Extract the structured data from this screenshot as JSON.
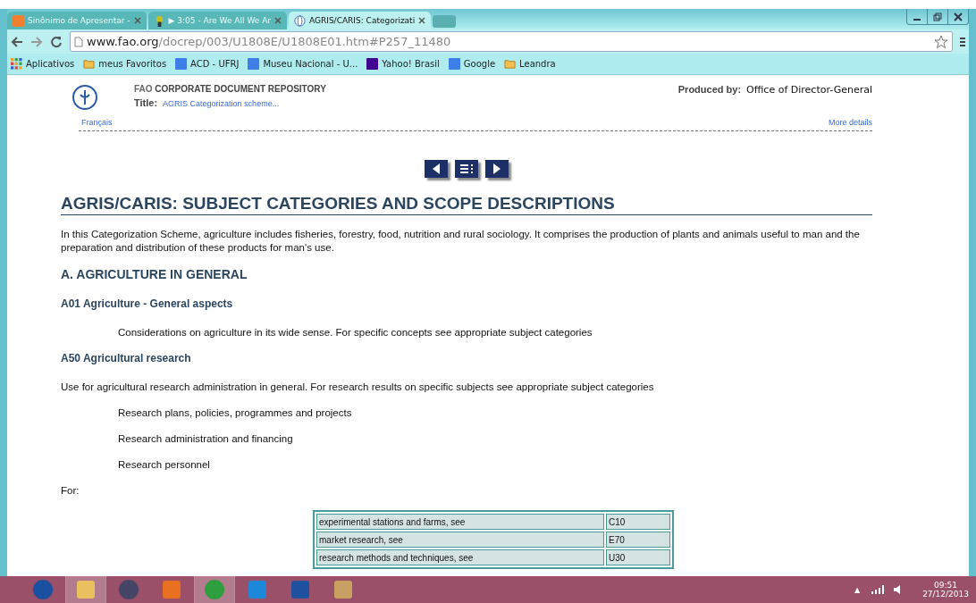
{
  "browser": {
    "tabs": [
      {
        "title": "Sinônimo de Apresentar -",
        "selected": false,
        "kind": "orange"
      },
      {
        "title": "▶ 3:05 - Are We All We Ar",
        "selected": false,
        "kind": "music"
      },
      {
        "title": "AGRIS/CARIS: Categorizati",
        "selected": true,
        "kind": "globe"
      }
    ],
    "url_host": "www.fao.org",
    "url_path": "/docrep/003/U1808E/U1808E01.htm#P257_11480",
    "bookmarks": [
      {
        "label": "Aplicativos",
        "kind": "apps"
      },
      {
        "label": "meus Favoritos",
        "kind": "folder"
      },
      {
        "label": "ACD - UFRJ",
        "kind": "google"
      },
      {
        "label": "Museu Nacional - U...",
        "kind": "google"
      },
      {
        "label": "Yahoo! Brasil",
        "kind": "yahoo"
      },
      {
        "label": "Google",
        "kind": "google"
      },
      {
        "label": "Leandra",
        "kind": "folder"
      }
    ]
  },
  "header": {
    "repo_prefix": "FAO",
    "repo": "CORPORATE DOCUMENT REPOSITORY",
    "title_label": "Title:",
    "title": "AGRIS Categorization scheme...",
    "produced_label": "Produced by:",
    "produced": "Office of Director-General",
    "lang_link": "Français",
    "more_link": "More details"
  },
  "heading": "AGRIS/CARIS: SUBJECT CATEGORIES AND SCOPE DESCRIPTIONS",
  "intro": "In this Categorization Scheme, agriculture includes fisheries, forestry, food, nutrition and rural sociology. It comprises the production of plants and animals useful to man and the preparation and distribution of these products for man's use.",
  "section": "A. AGRICULTURE IN GENERAL",
  "blocks": [
    {
      "kind": "sub",
      "text": "A01 Agriculture - General aspects"
    },
    {
      "kind": "indent",
      "text": "Considerations on agriculture in its wide sense. For specific concepts see appropriate subject categories"
    },
    {
      "kind": "sub",
      "text": "A50 Agricultural research"
    },
    {
      "kind": "para",
      "text": "Use for agricultural research administration in general. For research results on specific subjects see appropriate subject categories"
    },
    {
      "kind": "indent",
      "text": "Research plans, policies, programmes and projects"
    },
    {
      "kind": "indent",
      "text": "Research administration and financing"
    },
    {
      "kind": "indent",
      "text": "Research personnel"
    },
    {
      "kind": "para",
      "text": "For:"
    }
  ],
  "table": {
    "rows": [
      {
        "text": "experimental stations and farms, see",
        "code": "C10"
      },
      {
        "text": "market research, see",
        "code": "E70"
      },
      {
        "text": "research methods and techniques, see",
        "code": "U30"
      }
    ]
  },
  "taskbar": {
    "apps": [
      {
        "kind": "help",
        "active": false
      },
      {
        "kind": "folder",
        "active": true
      },
      {
        "kind": "media",
        "active": false
      },
      {
        "kind": "office",
        "active": false
      },
      {
        "kind": "chrome",
        "active": true
      },
      {
        "kind": "ie",
        "active": false
      },
      {
        "kind": "word",
        "active": false
      },
      {
        "kind": "paint",
        "active": false
      }
    ],
    "time": "09:51",
    "date": "27/12/2013",
    "tray_arrow": "▲"
  }
}
